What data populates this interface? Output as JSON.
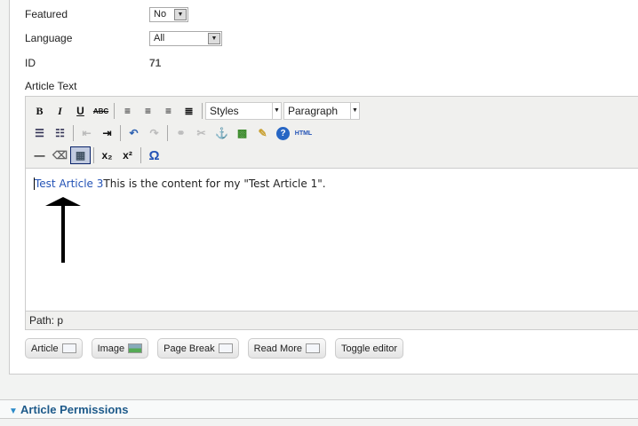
{
  "fields": {
    "featured_label": "Featured",
    "featured_value": "No",
    "language_label": "Language",
    "language_value": "All",
    "id_label": "ID",
    "id_value": "71",
    "article_text_label": "Article Text"
  },
  "toolbar": {
    "bold": "B",
    "italic": "I",
    "underline": "U",
    "strike": "ABC",
    "styles": "Styles",
    "format": "Paragraph",
    "html": "HTML",
    "sub": "x₂",
    "sup": "x²",
    "omega": "Ω"
  },
  "content": {
    "link_text": "Test Article 3",
    "body_text": "This is the content for my \"Test Article 1\"."
  },
  "path": "Path: p",
  "buttons": {
    "article": "Article",
    "image": "Image",
    "pagebreak": "Page Break",
    "readmore": "Read More",
    "toggle": "Toggle editor"
  },
  "permissions": {
    "title": "Article Permissions"
  }
}
